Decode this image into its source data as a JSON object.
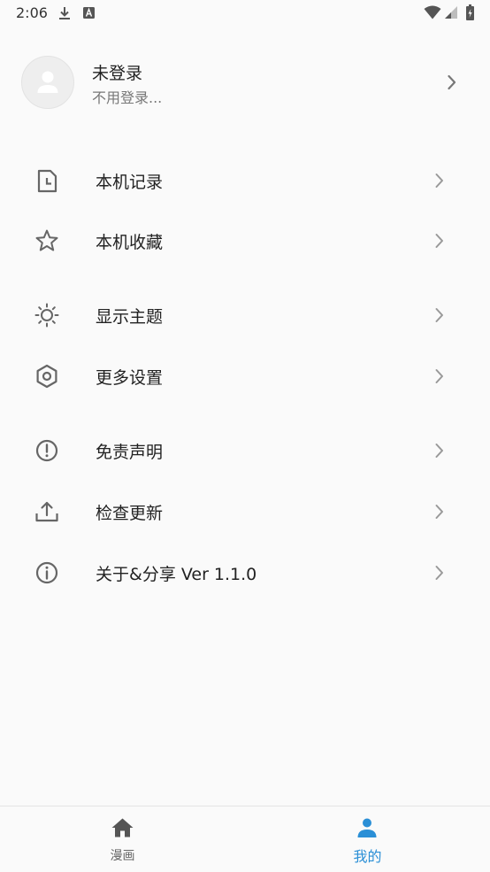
{
  "status_bar": {
    "time": "2:06",
    "icons": [
      "download-icon",
      "a-notification-icon",
      "wifi-icon",
      "signal-icon",
      "battery-icon"
    ]
  },
  "profile": {
    "name": "未登录",
    "subtitle": "不用登录...",
    "avatar_icon": "user-placeholder-icon",
    "chevron_icon": "chevron-right-icon"
  },
  "menu": [
    {
      "label": "本机记录",
      "icon": "history-file-icon"
    },
    {
      "label": "本机收藏",
      "icon": "star-outline-icon"
    },
    {
      "label": "显示主题",
      "icon": "brightness-icon"
    },
    {
      "label": "更多设置",
      "icon": "settings-hexagon-icon"
    },
    {
      "label": "免责声明",
      "icon": "alert-circle-icon"
    },
    {
      "label": "检查更新",
      "icon": "upload-icon"
    },
    {
      "label": "关于&分享 Ver 1.1.0",
      "icon": "info-circle-icon"
    }
  ],
  "bottom_nav": {
    "tabs": [
      {
        "label": "漫画",
        "icon": "home-icon",
        "active": false
      },
      {
        "label": "我的",
        "icon": "person-icon",
        "active": true
      }
    ]
  },
  "colors": {
    "background": "#fafafa",
    "accent": "#2a8fd6",
    "icon_gray": "#666666",
    "chevron_gray": "#999999",
    "text_primary": "#212121",
    "text_secondary": "#777777"
  }
}
